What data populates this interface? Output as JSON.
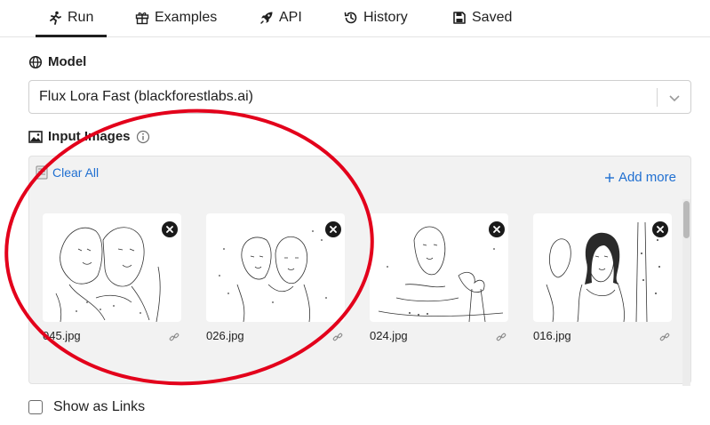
{
  "tabs": [
    {
      "label": "Run",
      "icon": "run-icon"
    },
    {
      "label": "Examples",
      "icon": "gift-icon"
    },
    {
      "label": "API",
      "icon": "rocket-icon"
    },
    {
      "label": "History",
      "icon": "history-icon"
    },
    {
      "label": "Saved",
      "icon": "save-icon"
    }
  ],
  "model": {
    "label": "Model",
    "selected": "Flux Lora Fast (blackforestlabs.ai)"
  },
  "input_images": {
    "label": "Input Images",
    "clear_all": "Clear All",
    "add_more": "Add more",
    "images": [
      {
        "filename": "045.jpg"
      },
      {
        "filename": "026.jpg"
      },
      {
        "filename": "024.jpg"
      },
      {
        "filename": "016.jpg"
      }
    ]
  },
  "show_as_links": {
    "label": "Show as Links",
    "checked": false
  },
  "colors": {
    "accent_link": "#1f6fd1",
    "annotation_circle": "#e3001b"
  }
}
